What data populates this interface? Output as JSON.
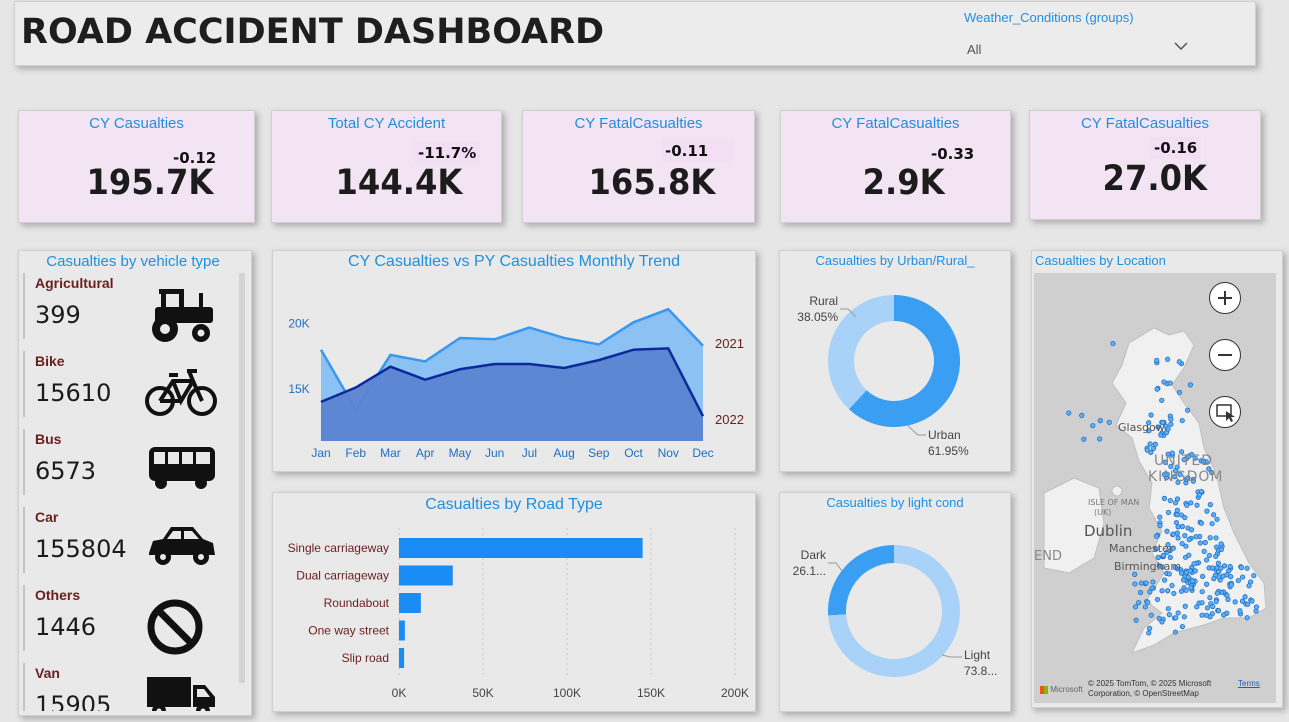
{
  "header": {
    "title": "ROAD ACCIDENT DASHBOARD",
    "slicer_label": "Weather_Conditions (groups)",
    "slicer_value": "All"
  },
  "kpis": [
    {
      "label": "CY Casualties",
      "value": "195.7K",
      "delta": "-0.12"
    },
    {
      "label": "Total CY Accident",
      "value": "144.4K",
      "delta": "-11.7%"
    },
    {
      "label": "CY FatalCasualties",
      "value": "165.8K",
      "delta": "-0.11"
    },
    {
      "label": "CY FatalCasualties",
      "value": "2.9K",
      "delta": "-0.33"
    },
    {
      "label": "CY FatalCasualties",
      "value": "27.0K",
      "delta": "-0.16"
    }
  ],
  "vehicles": {
    "title": "Casualties by vehicle type",
    "items": [
      {
        "name": "Agricultural",
        "count": "399",
        "icon": "tractor-icon"
      },
      {
        "name": "Bike",
        "count": "15610",
        "icon": "bicycle-icon"
      },
      {
        "name": "Bus",
        "count": "6573",
        "icon": "bus-icon"
      },
      {
        "name": "Car",
        "count": "155804",
        "icon": "car-icon"
      },
      {
        "name": "Others",
        "count": "1446",
        "icon": "prohibited-icon"
      },
      {
        "name": "Van",
        "count": "15905",
        "icon": "van-icon"
      }
    ]
  },
  "chart_data": [
    {
      "type": "area",
      "title": "CY Casualties vs PY Casualties Monthly Trend",
      "categories": [
        "Jan",
        "Feb",
        "Mar",
        "Apr",
        "May",
        "Jun",
        "Jul",
        "Aug",
        "Sep",
        "Oct",
        "Nov",
        "Dec"
      ],
      "yticks": [
        "15K",
        "20K"
      ],
      "ylim": [
        11000,
        22500
      ],
      "series": [
        {
          "name": "2021",
          "color": "#3a97f0",
          "values": [
            18000,
            13400,
            17600,
            17100,
            18900,
            18800,
            19700,
            18900,
            18400,
            20100,
            21100,
            18300
          ]
        },
        {
          "name": "2022",
          "color": "#0d2a9c",
          "values": [
            14000,
            15100,
            16700,
            15700,
            16500,
            16900,
            16900,
            16600,
            17200,
            18000,
            18100,
            12900
          ]
        }
      ]
    },
    {
      "type": "bar",
      "title": "Casualties by Road Type",
      "categories": [
        "Single carriageway",
        "Dual carriageway",
        "Roundabout",
        "One way street",
        "Slip road"
      ],
      "values": [
        145000,
        32000,
        13000,
        3500,
        3000
      ],
      "xticks": [
        "0K",
        "50K",
        "100K",
        "150K",
        "200K"
      ],
      "xlim": [
        0,
        200000
      ],
      "color": "#1a8cf5"
    },
    {
      "type": "pie",
      "title": "Casualties by Urban/Rural_",
      "slices": [
        {
          "label": "Rural",
          "pct_label": "38.05%",
          "value": 38.05,
          "color": "#a8d2f7"
        },
        {
          "label": "Urban",
          "pct_label": "61.95%",
          "value": 61.95,
          "color": "#3a9ef3"
        }
      ]
    },
    {
      "type": "pie",
      "title": "Casualties by light cond",
      "slices": [
        {
          "label": "Dark",
          "pct_label": "26.1...",
          "value": 26.1,
          "color": "#3a9ef3"
        },
        {
          "label": "Light",
          "pct_label": "73.8...",
          "value": 73.9,
          "color": "#a8d2f7"
        }
      ]
    }
  ],
  "map": {
    "title": "Casualties by Location",
    "labels": [
      "Glasgow",
      "UNITED",
      "KINGDOM",
      "ISLE OF MAN",
      "(UK)",
      "Dublin",
      "Manchester",
      "Birmingham",
      "END"
    ],
    "attribution": "© 2025 TomTom, © 2025 Microsoft Corporation, © OpenStreetMap",
    "terms": "Terms",
    "brand": "Microsoft"
  }
}
